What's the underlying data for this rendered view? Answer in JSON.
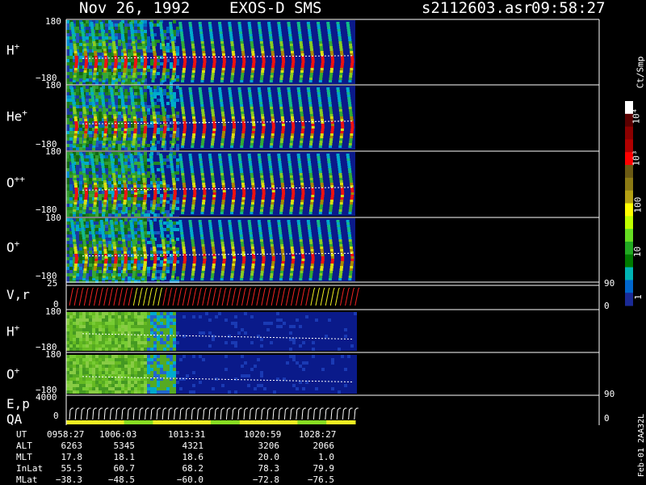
{
  "header": {
    "date": "Nov 26, 1992",
    "instrument": "EXOS-D SMS",
    "file": "s2112603.asr",
    "time": "09:58:27"
  },
  "panels": [
    {
      "id": "h-plus",
      "label_main": "H",
      "label_sup": "+",
      "tick_top": "180",
      "tick_bottom": "−180"
    },
    {
      "id": "he-plus",
      "label_main": "He",
      "label_sup": "+",
      "tick_top": "180",
      "tick_bottom": "−180"
    },
    {
      "id": "o-plus-plus",
      "label_main": "O",
      "label_sup": "++",
      "tick_top": "180",
      "tick_bottom": "−180"
    },
    {
      "id": "o-plus",
      "label_main": "O",
      "label_sup": "+",
      "tick_top": "180",
      "tick_bottom": "−180"
    },
    {
      "id": "vr",
      "label_main": "V,r",
      "label_sup": "",
      "tick_top": "25",
      "tick_bottom": "0",
      "right_top": "90",
      "right_bottom": "0"
    },
    {
      "id": "h-plus-2",
      "label_main": "H",
      "label_sup": "+",
      "tick_top": "180",
      "tick_bottom": "−180"
    },
    {
      "id": "o-plus-2",
      "label_main": "O",
      "label_sup": "+",
      "tick_top": "180",
      "tick_bottom": "−180"
    },
    {
      "id": "ep-qa",
      "label_main": "E,p",
      "label_line2": "QA",
      "label_sup": "",
      "tick_top": "4000",
      "tick_bottom": "0",
      "right_top": "90",
      "right_bottom": "0"
    }
  ],
  "colorbar": {
    "unit": "Ct/Smp",
    "labels": [
      "10⁴",
      "10³",
      "100",
      "10",
      "1"
    ],
    "colors": [
      "#ffffff",
      "#5a0000",
      "#8b0000",
      "#b00000",
      "#ff0000",
      "#6b5a14",
      "#8b7a14",
      "#b4a014",
      "#ffff00",
      "#bfff00",
      "#66dd22",
      "#22aa22",
      "#007a00",
      "#00b4b4",
      "#0066cc",
      "#1a2a96"
    ]
  },
  "footer": {
    "row_labels": [
      "UT",
      "ALT",
      "MLT",
      "InLat",
      "MLat"
    ],
    "columns": [
      {
        "UT": "0958:27",
        "ALT": "6263",
        "MLT": "17.8",
        "InLat": "55.5",
        "MLat": "−38.3"
      },
      {
        "UT": "1006:03",
        "ALT": "5345",
        "MLT": "18.1",
        "InLat": "60.7",
        "MLat": "−48.5"
      },
      {
        "UT": "1013:31",
        "ALT": "4321",
        "MLT": "18.6",
        "InLat": "68.2",
        "MLat": "−60.0"
      },
      {
        "UT": "1020:59",
        "ALT": "3206",
        "MLT": "20.0",
        "InLat": "78.3",
        "MLat": "−72.8"
      },
      {
        "UT": "1028:27",
        "ALT": "2066",
        "MLT": "1.0",
        "InLat": "79.9",
        "MLat": "−76.5"
      }
    ],
    "code": "Feb-01 2AA32L"
  },
  "chart_data": {
    "type": "heatmap",
    "title": "Nov 26, 1992   EXOS-D SMS",
    "x_ticks": [
      "0958:27",
      "1006:03",
      "1013:31",
      "1020:59",
      "1028:27"
    ],
    "panels": [
      "H+",
      "He+",
      "O++",
      "O+",
      "V,r",
      "H+",
      "O+",
      "E,p QA"
    ],
    "angle_range": [
      -180,
      180
    ],
    "color_scale": "log",
    "color_range_label": [
      "1",
      "10⁴"
    ],
    "legend_location": "right"
  }
}
